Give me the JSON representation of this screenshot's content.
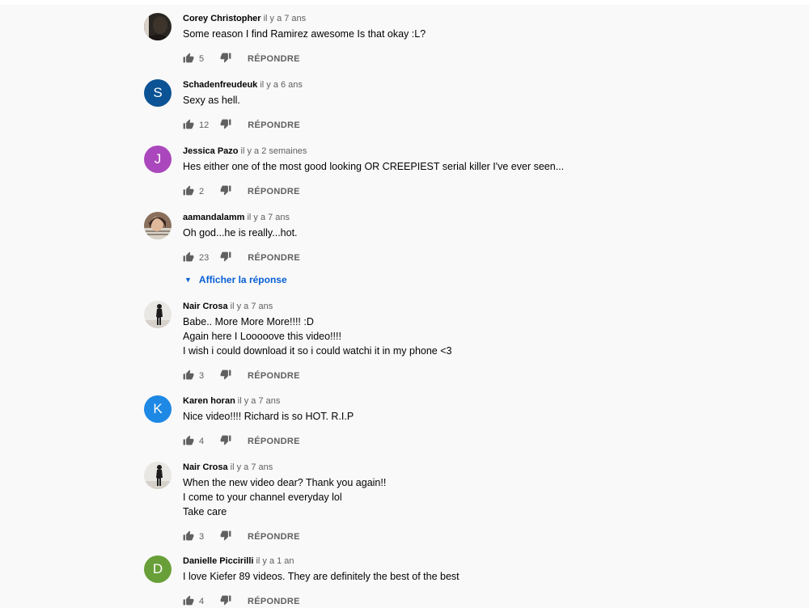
{
  "colors": {
    "background": "#f9f9f9",
    "link_blue": "#065fd4",
    "meta_gray": "#606060",
    "text_black": "#030303"
  },
  "reply_label": "RÉPONDRE",
  "comments": [
    {
      "author": "Corey Christopher",
      "date": "il y a 7 ans",
      "lines": [
        "Some reason I find Ramirez awesome Is that okay :L?"
      ],
      "likes": "5",
      "avatar": {
        "type": "photo",
        "icon": "dark-photo-avatar"
      }
    },
    {
      "author": "Schadenfreudeuk",
      "date": "il y a 6 ans",
      "lines": [
        "Sexy as hell."
      ],
      "likes": "12",
      "avatar": {
        "type": "letter",
        "letter": "S",
        "color": "#0b5394"
      }
    },
    {
      "author": "Jessica Pazo",
      "date": "il y a 2 semaines",
      "lines": [
        "Hes either one of the most good looking OR CREEPIEST serial killer I've ever seen..."
      ],
      "likes": "2",
      "avatar": {
        "type": "letter",
        "letter": "J",
        "color": "#ab47bc"
      }
    },
    {
      "author": "aamandalamm",
      "date": "il y a 7 ans",
      "lines": [
        "Oh god...he is really...hot."
      ],
      "likes": "23",
      "avatar": {
        "type": "photo",
        "icon": "portrait-photo-avatar"
      },
      "replies_toggle": "Afficher la réponse"
    },
    {
      "author": "Nair Crosa",
      "date": "il y a 7 ans",
      "lines": [
        "Babe.. More More More!!!! :D",
        "Again here I Looooove this video!!!!",
        "I wish i could download it so i could watchi it in my phone <3"
      ],
      "likes": "3",
      "avatar": {
        "type": "photo",
        "icon": "standing-figure-avatar"
      }
    },
    {
      "author": "Karen horan",
      "date": "il y a 7 ans",
      "lines": [
        "Nice video!!!! Richard is so HOT. R.I.P"
      ],
      "likes": "4",
      "avatar": {
        "type": "letter",
        "letter": "K",
        "color": "#1e88e5"
      }
    },
    {
      "author": "Nair Crosa",
      "date": "il y a 7 ans",
      "lines": [
        "When the new video dear? Thank you again!!",
        "I come to your channel everyday lol",
        "Take care"
      ],
      "likes": "3",
      "avatar": {
        "type": "photo",
        "icon": "standing-figure-avatar"
      }
    },
    {
      "author": "Danielle Piccirilli",
      "date": "il y a 1 an",
      "lines": [
        "I love Kiefer 89 videos. They are definitely the best of the best"
      ],
      "likes": "4",
      "avatar": {
        "type": "letter",
        "letter": "D",
        "color": "#689f38"
      }
    }
  ]
}
